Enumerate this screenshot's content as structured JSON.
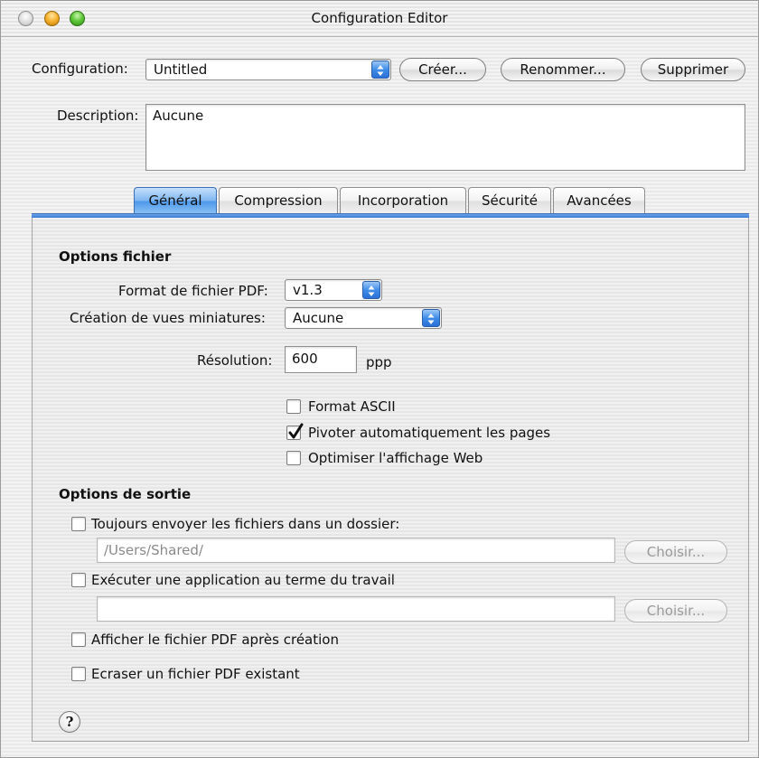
{
  "window": {
    "title": "Configuration Editor"
  },
  "top": {
    "config_label": "Configuration:",
    "config_value": "Untitled",
    "create_label": "Créer...",
    "rename_label": "Renommer...",
    "delete_label": "Supprimer",
    "description_label": "Description:",
    "description_value": "Aucune"
  },
  "tabs": [
    "Général",
    "Compression",
    "Incorporation",
    "Sécurité",
    "Avancées"
  ],
  "file_options": {
    "heading": "Options fichier",
    "pdf_format_label": "Format de fichier PDF:",
    "pdf_format_value": "v1.3",
    "thumbnails_label": "Création de vues miniatures:",
    "thumbnails_value": "Aucune",
    "resolution_label": "Résolution:",
    "resolution_value": "600",
    "resolution_unit": "ppp",
    "ascii_label": "Format ASCII",
    "ascii_checked": false,
    "rotate_label": "Pivoter automatiquement les pages",
    "rotate_checked": true,
    "web_label": "Optimiser l'affichage Web",
    "web_checked": false
  },
  "output_options": {
    "heading": "Options de sortie",
    "folder_label": "Toujours envoyer les fichiers dans un dossier:",
    "folder_checked": false,
    "folder_path": "/Users/Shared/",
    "choose_label": "Choisir...",
    "run_app_label": "Exécuter une application au terme du travail",
    "run_app_checked": false,
    "app_path": "",
    "show_pdf_label": "Afficher le fichier PDF après création",
    "show_pdf_checked": false,
    "overwrite_label": "Ecraser un fichier PDF existant",
    "overwrite_checked": false
  },
  "help": "?"
}
